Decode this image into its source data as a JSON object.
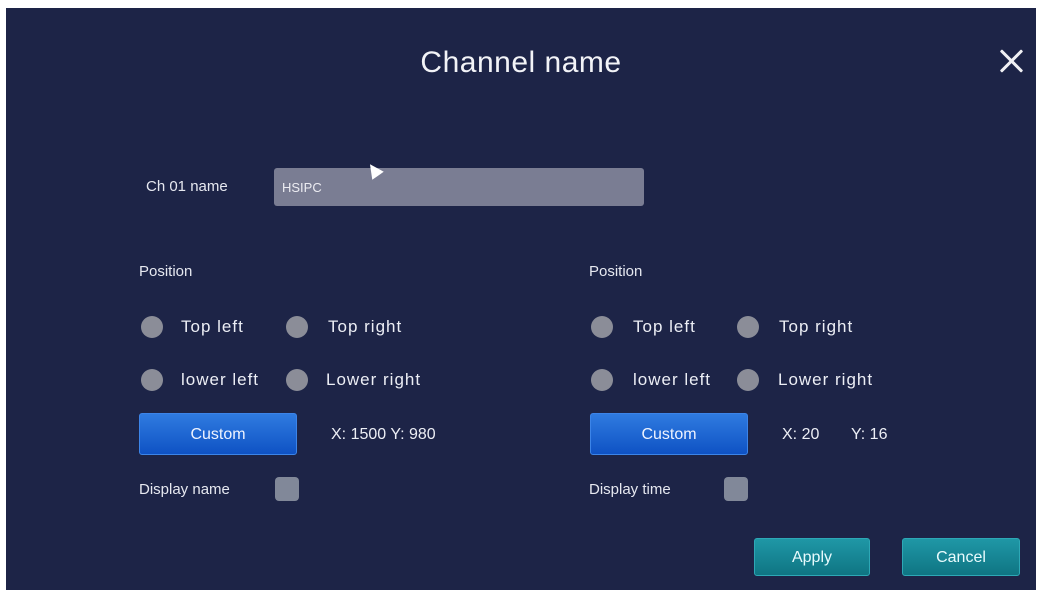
{
  "dialog": {
    "title": "Channel name",
    "close_icon": "close-icon"
  },
  "channel": {
    "label": "Ch 01 name",
    "value": "HSIPC"
  },
  "left_panel": {
    "position_label": "Position",
    "options": [
      "Top left",
      "Top right",
      "lower left",
      "Lower right"
    ],
    "custom_label": "Custom",
    "coord_text": "X: 1500 Y: 980",
    "display_label": "Display name"
  },
  "right_panel": {
    "position_label": "Position",
    "options": [
      "Top left",
      "Top right",
      "lower left",
      "Lower right"
    ],
    "custom_label": "Custom",
    "x_text": "X: 20",
    "y_text": "Y: 16",
    "display_label": "Display time"
  },
  "actions": {
    "apply_label": "Apply",
    "cancel_label": "Cancel"
  },
  "colors": {
    "background": "#1d2447",
    "custom_button": "#1560d4",
    "action_button": "#14838f",
    "radio": "#8b8d98"
  }
}
